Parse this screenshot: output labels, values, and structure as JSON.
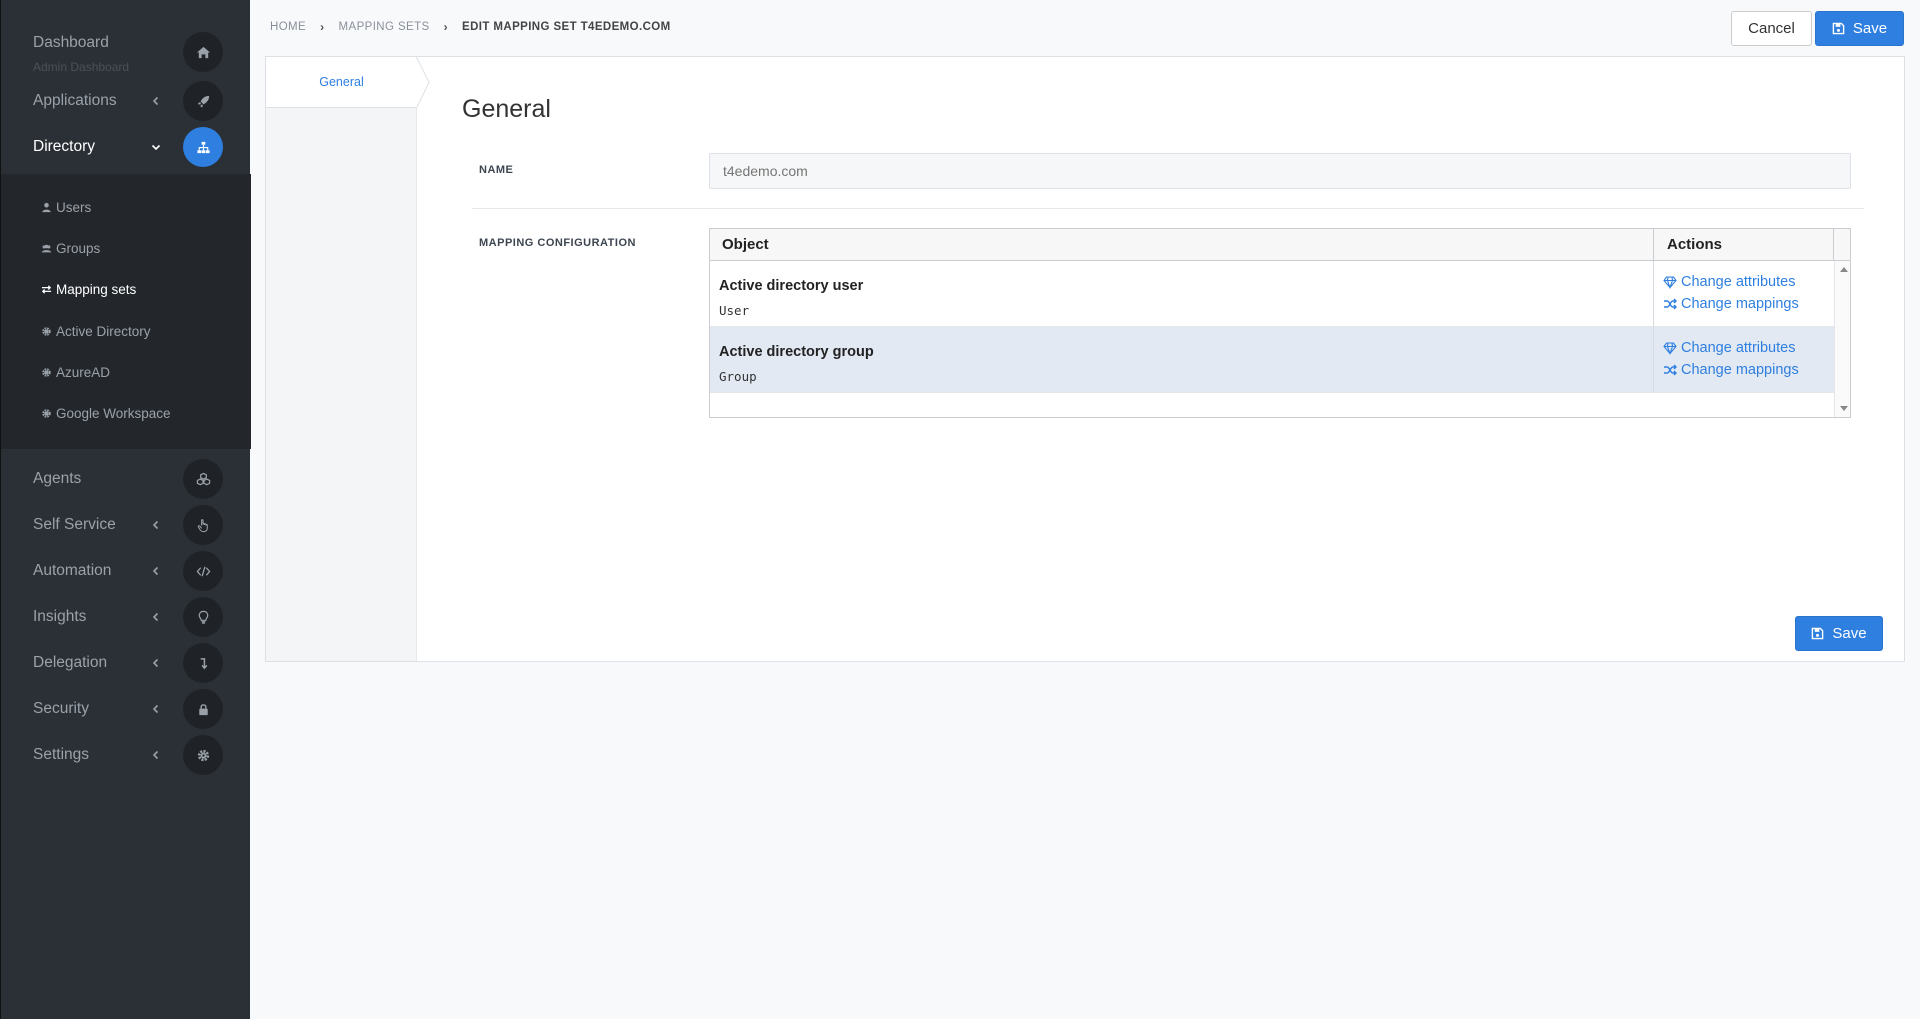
{
  "sidebar": {
    "dashboard": {
      "label": "Dashboard",
      "subtitle": "Admin Dashboard",
      "icon": "home-icon"
    },
    "items": [
      {
        "label": "Applications",
        "icon": "rocket-icon"
      },
      {
        "label": "Directory",
        "icon": "sitemap-icon"
      },
      {
        "label": "Agents",
        "icon": "cubes-icon"
      },
      {
        "label": "Self Service",
        "icon": "hand-pointer-icon"
      },
      {
        "label": "Automation",
        "icon": "code-icon"
      },
      {
        "label": "Insights",
        "icon": "lightbulb-icon"
      },
      {
        "label": "Delegation",
        "icon": "level-down-icon"
      },
      {
        "label": "Security",
        "icon": "lock-icon"
      },
      {
        "label": "Settings",
        "icon": "gear-icon"
      }
    ],
    "directory_sub": [
      {
        "label": "Users",
        "icon": "user-icon"
      },
      {
        "label": "Groups",
        "icon": "users-icon"
      },
      {
        "label": "Mapping sets",
        "icon": "exchange-icon"
      },
      {
        "label": "Active Directory",
        "icon": "gear-icon"
      },
      {
        "label": "AzureAD",
        "icon": "gear-icon"
      },
      {
        "label": "Google Workspace",
        "icon": "gear-icon"
      }
    ]
  },
  "breadcrumb": {
    "home": "HOME",
    "mapping_sets": "MAPPING SETS",
    "current": "EDIT MAPPING SET T4EDEMO.COM"
  },
  "toolbar": {
    "cancel_label": "Cancel",
    "save_label": "Save"
  },
  "tabs": {
    "general": "General"
  },
  "form": {
    "section_title": "General",
    "name_label": "NAME",
    "name_placeholder": "t4edemo.com",
    "mapping_label": "MAPPING CONFIGURATION"
  },
  "table": {
    "headers": {
      "object": "Object",
      "actions": "Actions"
    },
    "rows": [
      {
        "title": "Active directory user",
        "type": "User",
        "action1": "Change attributes",
        "action2": "Change mappings"
      },
      {
        "title": "Active directory group",
        "type": "Group",
        "action1": "Change attributes",
        "action2": "Change mappings"
      }
    ]
  },
  "colors": {
    "accent": "#2e7fe0",
    "sidebar": "#2b3036",
    "selected_row": "#e2e9f3"
  }
}
